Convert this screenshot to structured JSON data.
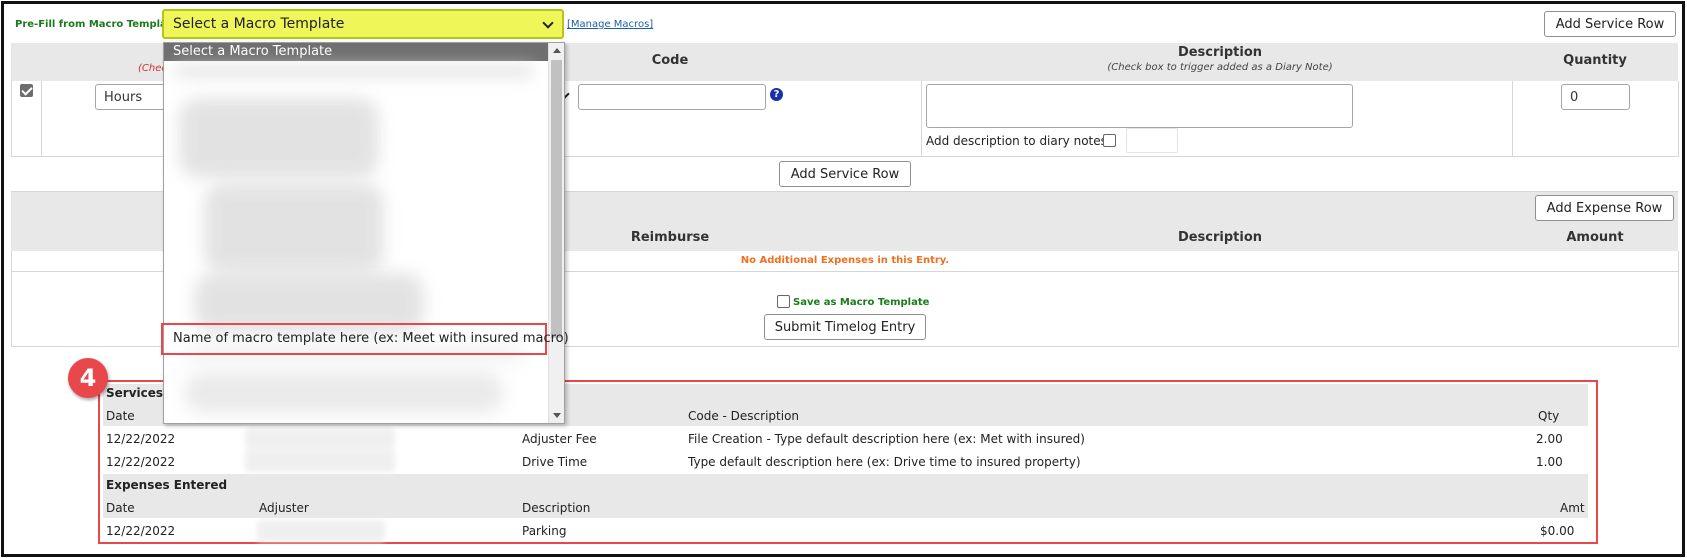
{
  "macro": {
    "prefill_label": "Pre-Fill from Macro Template",
    "select_value": "Select a Macro Template",
    "manage_link": "[Manage Macros]",
    "dropdown_options": [
      "Select a Macro Template",
      "Name of macro template here (ex: Meet with insured macro)"
    ]
  },
  "services": {
    "add_row_label": "Add Service Row",
    "hint_fragment": "(Chec",
    "headers": {
      "code": "Code",
      "description": "Description",
      "description_sub": "(Check box to trigger added as a Diary Note)",
      "quantity": "Quantity"
    },
    "row": {
      "unit_value": "Hours",
      "code_value": "",
      "description_value": "",
      "diary_label": "Add description to diary notes?",
      "quantity_value": "0"
    },
    "add_row_bottom_label": "Add Service Row"
  },
  "expenses": {
    "add_row_label": "Add Expense Row",
    "headers": {
      "reimburse": "Reimburse",
      "description": "Description",
      "amount": "Amount"
    },
    "empty_message": "No Additional Expenses in this Entry."
  },
  "footer": {
    "save_macro_label": "Save as Macro Template",
    "submit_label": "Submit Timelog Entry"
  },
  "callout": {
    "number": "4"
  },
  "services_entered": {
    "title_fragment": "Services E",
    "headers": {
      "date": "Date",
      "code_desc": "Code - Description",
      "qty": "Qty"
    },
    "rows": [
      {
        "date": "12/22/2022",
        "type": "Adjuster Fee",
        "code_desc": "File Creation - Type default description here (ex: Met with insured)",
        "qty": "2.00"
      },
      {
        "date": "12/22/2022",
        "type": "Drive Time",
        "code_desc": "Type default description here (ex: Drive time to insured property)",
        "qty": "1.00"
      }
    ]
  },
  "expenses_entered": {
    "title": "Expenses Entered",
    "headers": {
      "date": "Date",
      "adjuster": "Adjuster",
      "description": "Description",
      "amt": "Amt"
    },
    "rows": [
      {
        "date": "12/22/2022",
        "description": "Parking",
        "amt": "$0.00"
      }
    ]
  }
}
